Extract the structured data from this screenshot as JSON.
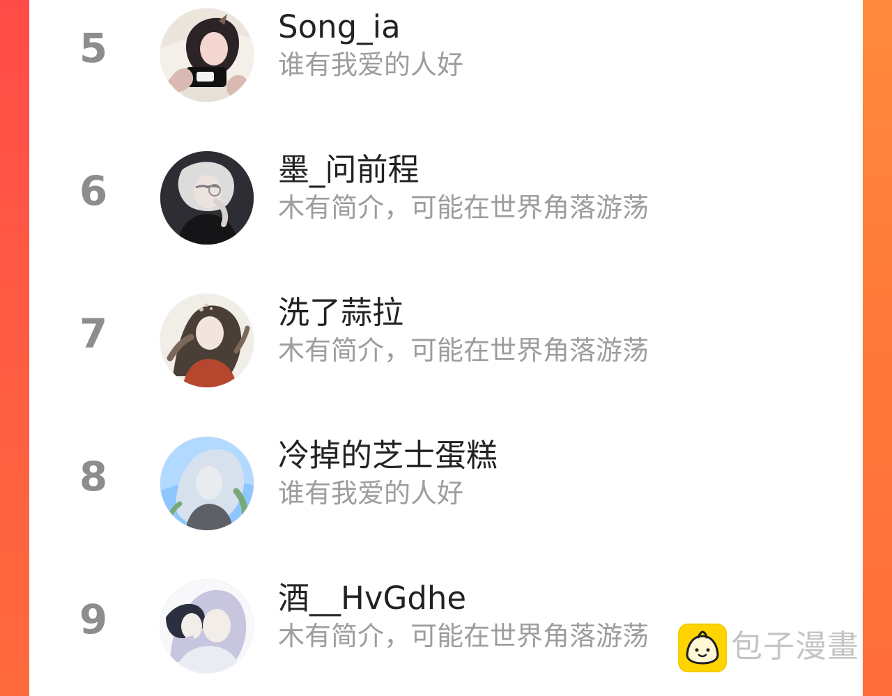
{
  "ranking": {
    "rows": [
      {
        "rank": "5",
        "name": "Song_ia",
        "bio": "谁有我爱的人好",
        "avatar_icon": "avatar-image",
        "avatar_colors": {
          "bg": "#f4efe8",
          "hair": "#2b2325",
          "skin": "#f2d6cf",
          "shirt": "#e7e0d7",
          "accent": "#7b6158"
        }
      },
      {
        "rank": "6",
        "name": "墨_问前程",
        "bio": "木有简介，可能在世界角落游荡",
        "avatar_icon": "avatar-image",
        "avatar_colors": {
          "bg": "#24242a",
          "hair": "#dcdcdc",
          "skin": "#ece3df",
          "shirt": "#151518",
          "accent": "#8b8b8f"
        }
      },
      {
        "rank": "7",
        "name": "洗了蒜拉",
        "bio": "木有简介，可能在世界角落游荡",
        "avatar_icon": "avatar-image",
        "avatar_colors": {
          "bg": "#f1ede7",
          "hair": "#4a3f37",
          "skin": "#f3e4dc",
          "shirt": "#b6472e",
          "accent": "#d7c8bc"
        }
      },
      {
        "rank": "8",
        "name": "冷掉的芝士蛋糕",
        "bio": "谁有我爱的人好",
        "avatar_icon": "avatar-image",
        "avatar_colors": {
          "bg": "#8ec7ff",
          "hair": "#d7e1ee",
          "skin": "#e9ecef",
          "shirt": "#5d6167",
          "accent": "#79a978"
        }
      },
      {
        "rank": "9",
        "name": "酒__HvGdhe",
        "bio": "木有简介，可能在世界角落游荡",
        "avatar_icon": "avatar-image",
        "avatar_colors": {
          "bg": "#f8f8fb",
          "hair": "#c8c6df",
          "skin": "#f2ede8",
          "shirt": "#e9edf3",
          "accent": "#2b2f3f"
        }
      }
    ]
  },
  "watermark": {
    "text": "包子漫畫",
    "icon": "baozi-icon"
  }
}
